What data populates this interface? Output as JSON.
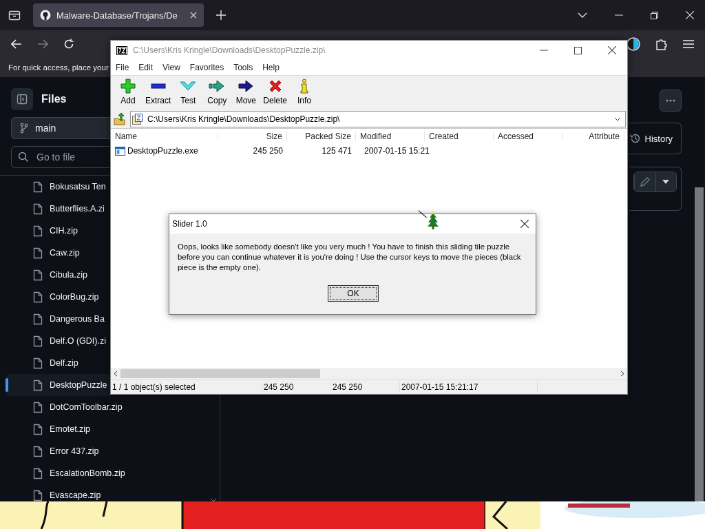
{
  "browser": {
    "tab": {
      "title": "Malware-Database/Trojans/De"
    },
    "bookmarks_hint": "For quick access, place your"
  },
  "sidebar": {
    "title": "Files",
    "branch": "main",
    "search": {
      "placeholder": "Go to file"
    },
    "files": [
      {
        "name": "Bokusatsu Ten",
        "selected": false
      },
      {
        "name": "Butterflies.A.zi",
        "selected": false
      },
      {
        "name": "CIH.zip",
        "selected": false
      },
      {
        "name": "Caw.zip",
        "selected": false
      },
      {
        "name": "Cibula.zip",
        "selected": false
      },
      {
        "name": "ColorBug.zip",
        "selected": false
      },
      {
        "name": "Dangerous Ba",
        "selected": false
      },
      {
        "name": "Delf.O (GDI).zi",
        "selected": false
      },
      {
        "name": "Delf.zip",
        "selected": false
      },
      {
        "name": "DesktopPuzzle",
        "selected": true
      },
      {
        "name": "DotComToolbar.zip",
        "selected": false
      },
      {
        "name": "Emotet.zip",
        "selected": false
      },
      {
        "name": "Error 437.zip",
        "selected": false
      },
      {
        "name": "EscalationBomb.zip",
        "selected": false
      },
      {
        "name": "Evascape.zip",
        "selected": false
      }
    ]
  },
  "repo_actions": {
    "history": "History"
  },
  "archive_window": {
    "title": "C:\\Users\\Kris Kringle\\Downloads\\DesktopPuzzle.zip\\",
    "menu": [
      "File",
      "Edit",
      "View",
      "Favorites",
      "Tools",
      "Help"
    ],
    "toolbar": [
      {
        "label": "Add",
        "kind": "add"
      },
      {
        "label": "Extract",
        "kind": "extract"
      },
      {
        "label": "Test",
        "kind": "test"
      },
      {
        "label": "Copy",
        "kind": "copy"
      },
      {
        "label": "Move",
        "kind": "move"
      },
      {
        "label": "Delete",
        "kind": "delete"
      },
      {
        "label": "Info",
        "kind": "info"
      }
    ],
    "path": "C:\\Users\\Kris Kringle\\Downloads\\DesktopPuzzle.zip\\",
    "columns": [
      "Name",
      "Size",
      "Packed Size",
      "Modified",
      "Created",
      "Accessed",
      "Attribute"
    ],
    "rows": [
      {
        "name": "DesktopPuzzle.exe",
        "size": "245 250",
        "packed_size": "125 471",
        "modified": "2007-01-15 15:21"
      }
    ],
    "status_bar": [
      "1 / 1 object(s) selected",
      "245 250",
      "245 250",
      "2007-01-15 15:21:17"
    ]
  },
  "dialog": {
    "title": "Slider 1.0",
    "message": "Oops, looks like somebody doesn't like you very much ! You have to finish this sliding tile puzzle before you can continue whatever it is you're doing ! Use the cursor keys to move the pieces (black piece is the empty one).",
    "button": "OK"
  }
}
